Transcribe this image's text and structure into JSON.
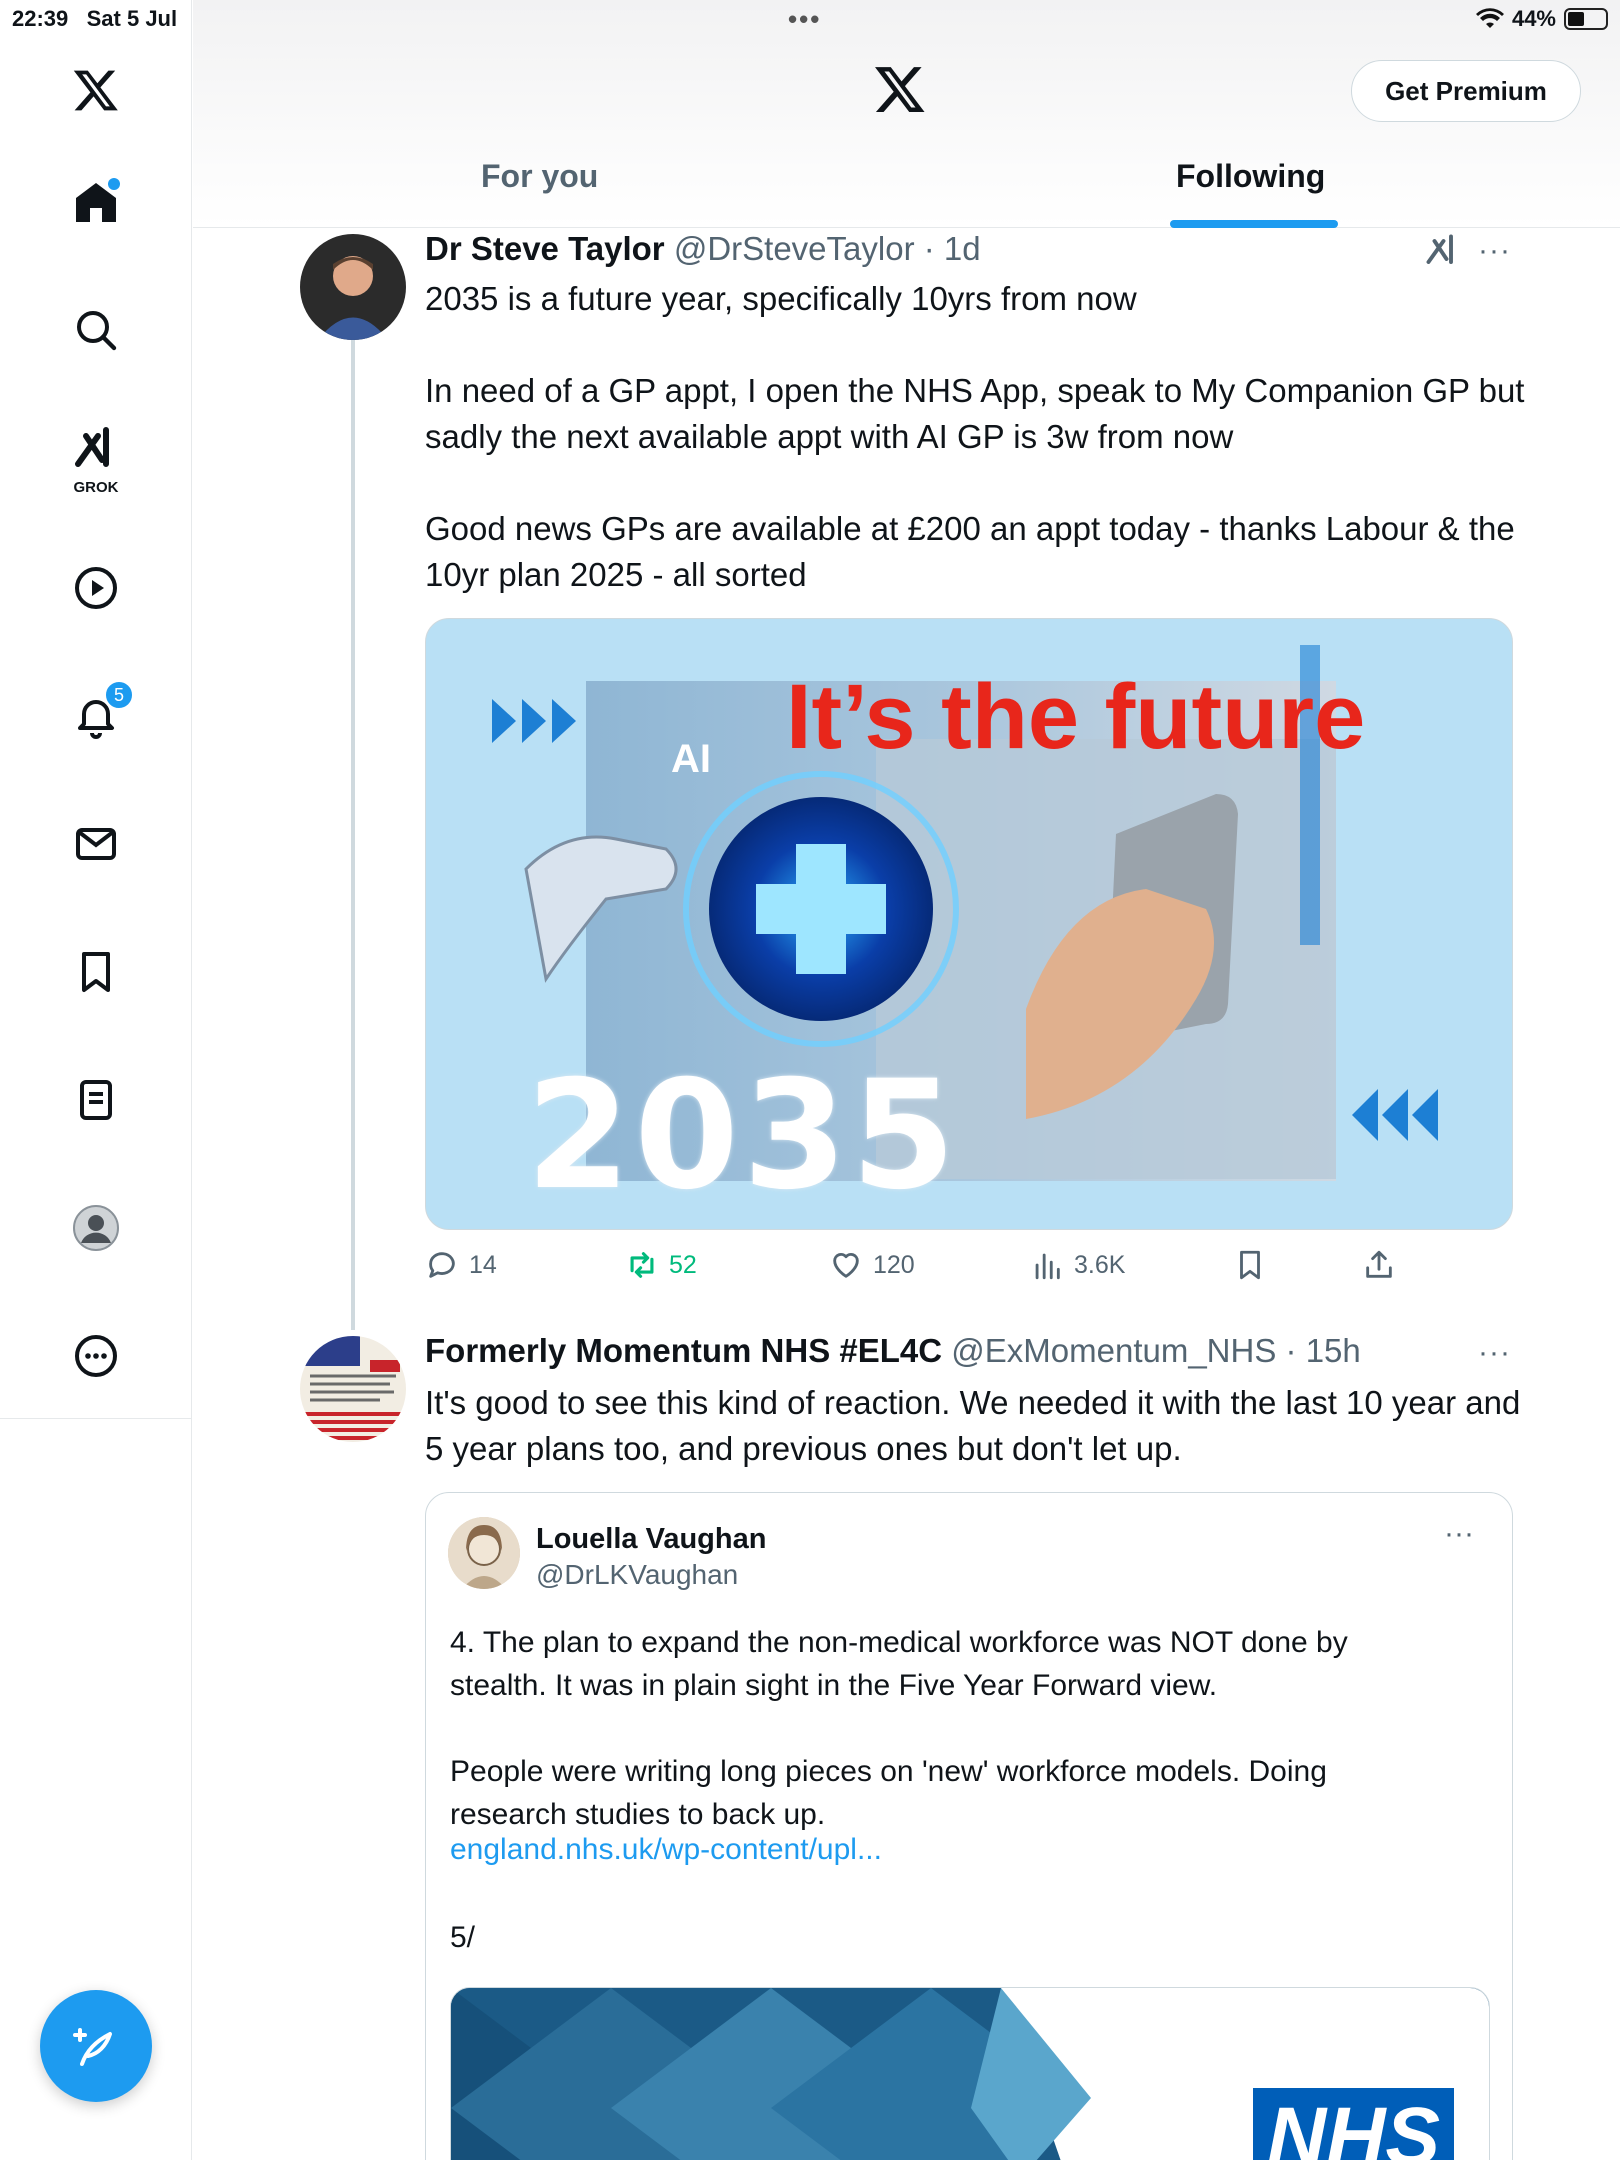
{
  "status_bar": {
    "time": "22:39",
    "date": "Sat 5 Jul",
    "battery": "44%",
    "battery_fraction": 0.44
  },
  "sidebar": {
    "grok_label": "GROK",
    "notifications_badge": "5"
  },
  "header": {
    "premium_label": "Get Premium",
    "tabs": [
      {
        "label": "For you"
      },
      {
        "label": "Following"
      }
    ],
    "active_tab": "Following"
  },
  "tweets": [
    {
      "name": "Dr Steve Taylor",
      "handle": "@DrSteveTaylor",
      "time": "1d",
      "text": "2035 is a future year, specifically 10yrs from now\n\nIn need of a GP appt, I open the NHS App, speak to My Companion GP but sadly the next available appt with AI GP is 3w from now\n\nGood news GPs are available at £200 an appt today - thanks Labour & the 10yr plan 2025 - all sorted",
      "media": {
        "title": "It’s the future",
        "year": "2035",
        "ai_label": "AI"
      },
      "replies": "14",
      "reposts": "52",
      "likes": "120",
      "views": "3.6K"
    },
    {
      "name": "Formerly Momentum NHS #EL4C",
      "handle": "@ExMomentum_NHS",
      "time": "15h",
      "text": "It's good to see this kind of reaction. We needed it with the last 10 year and 5 year plans too, and previous ones but don't let up.",
      "quote": {
        "name": "Louella Vaughan",
        "handle": "@DrLKVaughan",
        "text": "4. The plan to expand the non-medical workforce was NOT done by stealth. It was in plain sight in the Five Year Forward view.\n\nPeople were writing long pieces on 'new' workforce models. Doing research studies to back up.",
        "link": "england.nhs.uk/wp-content/upl...",
        "page": "5/",
        "media_logo": "NHS"
      }
    }
  ],
  "colors": {
    "accent": "#1d9bf0",
    "repost": "#00ba7c",
    "media_title": "#e8261b"
  }
}
